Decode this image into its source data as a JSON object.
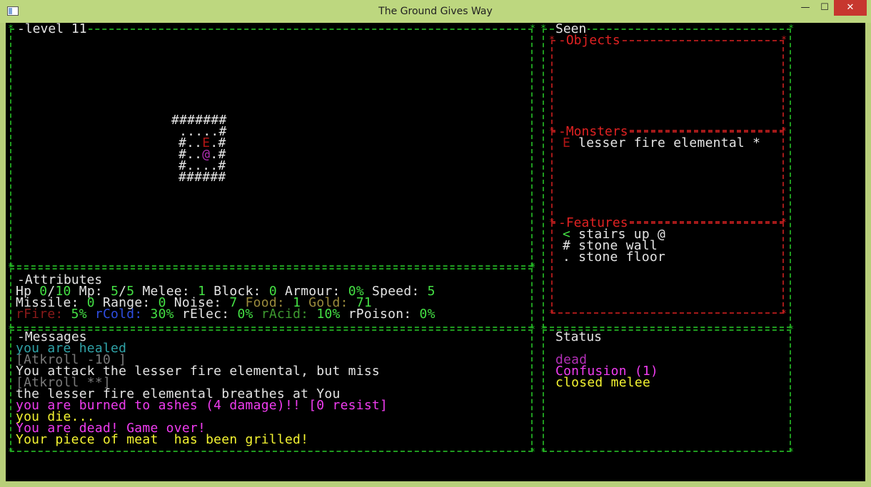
{
  "window": {
    "title": "The Ground Gives Way",
    "minimize": "—",
    "maximize": "☐",
    "close": "✕"
  },
  "map": {
    "title": "level 11",
    "rows": [
      "#######",
      " .....#",
      "#..",
      "E",
      ".#",
      "#..",
      "@",
      ".#",
      "#....#",
      "######"
    ],
    "colors": {
      "wall": "#d8d8d8",
      "monster": "#b01515",
      "player": "#b22fb6"
    }
  },
  "attributes": {
    "title": "Attributes",
    "hp_label": "Hp ",
    "hp_cur": "0",
    "hp_sep": "/",
    "hp_max": "10",
    "mp_label": " Mp: ",
    "mp_cur": "5",
    "mp_sep": "/",
    "mp_max": "5",
    "melee_label": " Melee: ",
    "melee": "1",
    "block_label": " Block: ",
    "block": "0",
    "armour_label": " Armour: ",
    "armour": "0%",
    "speed_label": " Speed: ",
    "speed": "5",
    "missile_label": "Missile: ",
    "missile": "0",
    "range_label": " Range: ",
    "range": "0",
    "noise_label": " Noise: ",
    "noise": "7",
    "food_label": " Food: ",
    "food": "1",
    "gold_label": " Gold: ",
    "gold": "71",
    "rfire_label": "rFire: ",
    "rfire": "5%",
    "rcold_label": " rCold: ",
    "rcold": "30%",
    "relec_label": " rElec: ",
    "relec": "0%",
    "racid_label": " rAcid: ",
    "racid": "10%",
    "rpoison_label": " rPoison: ",
    "rpoison": "0%"
  },
  "messages": {
    "title": "Messages",
    "lines": [
      "you are healed",
      "[Atkroll -10 ]",
      "You attack the lesser fire elemental, but miss",
      "[Atkroll **]",
      "the lesser fire elemental breathes at You",
      "you are burned to ashes (4 damage)!! [0 resist]",
      "you die...",
      "You are dead! Game over!",
      "Your piece of meat  has been grilled!"
    ]
  },
  "seen": {
    "title": "Seen",
    "objects_title": "Objects",
    "monsters_title": "Monsters",
    "monster_glyph": "E",
    "monster_name": " lesser fire elemental ",
    "monster_mark": "*",
    "features_title": "Features",
    "features": [
      {
        "glyph": "<",
        "name": " stairs up @"
      },
      {
        "glyph": "#",
        "name": " stone wall"
      },
      {
        "glyph": ".",
        "name": " stone floor"
      }
    ]
  },
  "status": {
    "title": "Status",
    "lines": [
      "dead",
      "Confusion (1)",
      "closed melee"
    ]
  }
}
